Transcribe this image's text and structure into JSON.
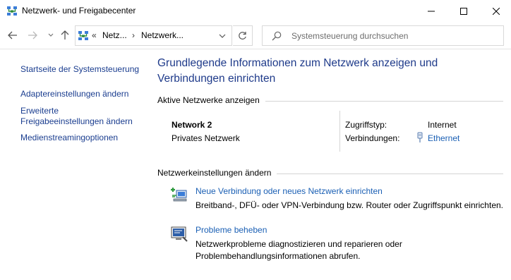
{
  "window": {
    "title": "Netzwerk- und Freigabecenter"
  },
  "nav": {
    "address_chevron": "«",
    "address_segments": [
      "Netz...",
      "Netzwerk..."
    ],
    "address_separator": "›",
    "search_placeholder": "Systemsteuerung durchsuchen"
  },
  "sidebar": {
    "links": [
      "Startseite der Systemsteuerung",
      "Adaptereinstellungen ändern",
      "Erweiterte Freigabeeinstellungen ändern",
      "Medienstreamingoptionen"
    ]
  },
  "main": {
    "heading": "Grundlegende Informationen zum Netzwerk anzeigen und Verbindungen einrichten",
    "active_networks_title": "Aktive Netzwerke anzeigen",
    "network": {
      "name": "Network 2",
      "type": "Privates Netzwerk",
      "access_label": "Zugriffstyp:",
      "access_value": "Internet",
      "connections_label": "Verbindungen:",
      "connection_value": "Ethernet"
    },
    "change_settings_title": "Netzwerkeinstellungen ändern",
    "tasks": [
      {
        "link": "Neue Verbindung oder neues Netzwerk einrichten",
        "description": "Breitband-, DFÜ- oder VPN-Verbindung bzw. Router oder Zugriffspunkt einrichten."
      },
      {
        "link": "Probleme beheben",
        "description": "Netzwerkprobleme diagnostizieren und reparieren oder Problembehandlungsinformationen abrufen."
      }
    ]
  },
  "icons": {
    "app": "network-center-icon",
    "back": "arrow-left-icon",
    "forward": "arrow-right-icon",
    "recent": "chevron-down-icon",
    "up": "arrow-up-icon",
    "refresh": "refresh-icon",
    "search": "search-icon",
    "connection": "ethernet-icon",
    "new_connection": "new-connection-icon",
    "troubleshoot": "troubleshoot-icon"
  },
  "colors": {
    "link": "#1a5fb4",
    "heading": "#1e3a8a",
    "sidebar_link": "#1a3d8f"
  }
}
